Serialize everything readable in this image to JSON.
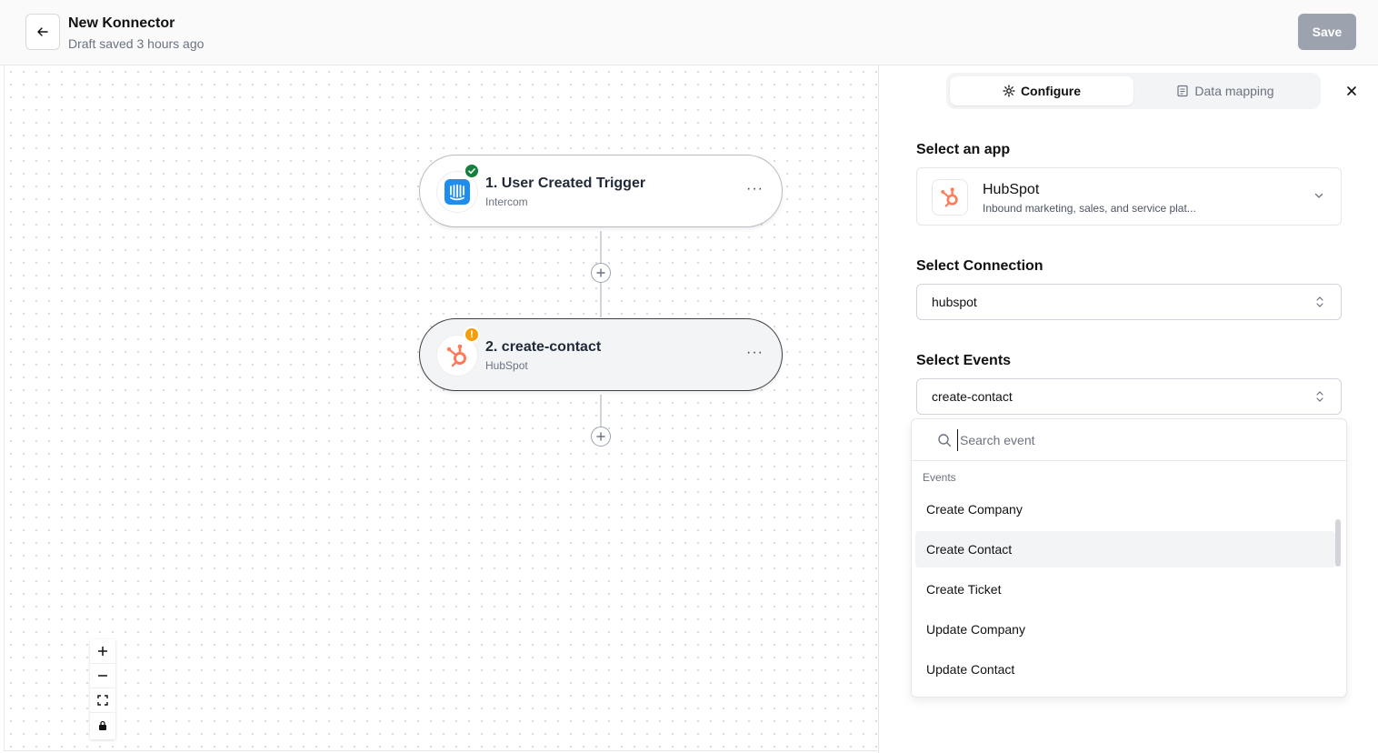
{
  "header": {
    "title": "New Konnector",
    "subtitle": "Draft saved 3 hours ago",
    "save_label": "Save"
  },
  "canvas": {
    "nodes": [
      {
        "title": "1. User Created Trigger",
        "subtitle": "Intercom",
        "status": "success",
        "more": "···"
      },
      {
        "title": "2. create-contact",
        "subtitle": "HubSpot",
        "status": "warning",
        "warning_glyph": "!",
        "more": "···"
      }
    ]
  },
  "panel": {
    "tabs": [
      {
        "label": "Configure"
      },
      {
        "label": "Data mapping"
      }
    ],
    "select_app_label": "Select an app",
    "app": {
      "name": "HubSpot",
      "description": "Inbound marketing, sales, and service plat..."
    },
    "select_connection_label": "Select Connection",
    "connection_value": "hubspot",
    "select_events_label": "Select Events",
    "events_value": "create-contact",
    "dropdown": {
      "search_placeholder": "Search event",
      "group_label": "Events",
      "items": [
        "Create Company",
        "Create Contact",
        "Create Ticket",
        "Update Company",
        "Update Contact"
      ],
      "highlighted": "Create Contact"
    }
  },
  "colors": {
    "hubspot": "#ff7a59",
    "intercom": "#1f8ded",
    "success": "#15803d",
    "warning": "#f59e0b"
  }
}
